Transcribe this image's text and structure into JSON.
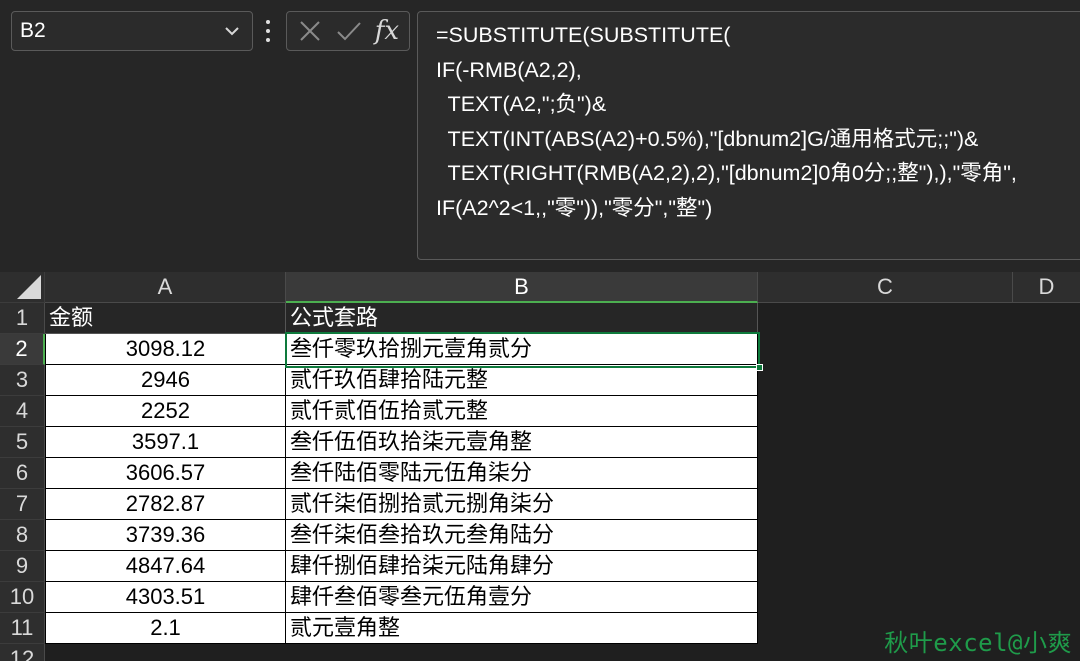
{
  "name_box": {
    "value": "B2"
  },
  "formula_bar": {
    "formula": "=SUBSTITUTE(SUBSTITUTE(\nIF(-RMB(A2,2),\n  TEXT(A2,\";负\")&\n  TEXT(INT(ABS(A2)+0.5%),\"[dbnum2]G/通用格式元;;\")&\n  TEXT(RIGHT(RMB(A2,2),2),\"[dbnum2]0角0分;;整\"),),\"零角\",\nIF(A2^2<1,,\"零\")),\"零分\",\"整\")",
    "fx_label": "fx",
    "cancel_icon": "x-icon",
    "enter_icon": "check-icon"
  },
  "columns": [
    "A",
    "B",
    "C",
    "D"
  ],
  "rows": [
    "1",
    "2",
    "3",
    "4",
    "5",
    "6",
    "7",
    "8",
    "9",
    "10",
    "11",
    "12"
  ],
  "header_row": {
    "a": "金额",
    "b": "公式套路"
  },
  "data_rows": [
    {
      "a": "3098.12",
      "b": "叁仟零玖拾捌元壹角贰分"
    },
    {
      "a": "2946",
      "b": "贰仟玖佰肆拾陆元整"
    },
    {
      "a": "2252",
      "b": "贰仟贰佰伍拾贰元整"
    },
    {
      "a": "3597.1",
      "b": "叁仟伍佰玖拾柒元壹角整"
    },
    {
      "a": "3606.57",
      "b": "叁仟陆佰零陆元伍角柒分"
    },
    {
      "a": "2782.87",
      "b": "贰仟柒佰捌拾贰元捌角柒分"
    },
    {
      "a": "3739.36",
      "b": "叁仟柒佰叁拾玖元叁角陆分"
    },
    {
      "a": "4847.64",
      "b": "肆仟捌佰肆拾柒元陆角肆分"
    },
    {
      "a": "4303.51",
      "b": "肆仟叁佰零叁元伍角壹分"
    },
    {
      "a": "2.1",
      "b": "贰元壹角整"
    }
  ],
  "selected": {
    "column": "B",
    "row": "2"
  },
  "watermark": "秋叶excel@小爽",
  "colors": {
    "accent": "#0e7a3c",
    "watermark": "#1f9b4a"
  }
}
